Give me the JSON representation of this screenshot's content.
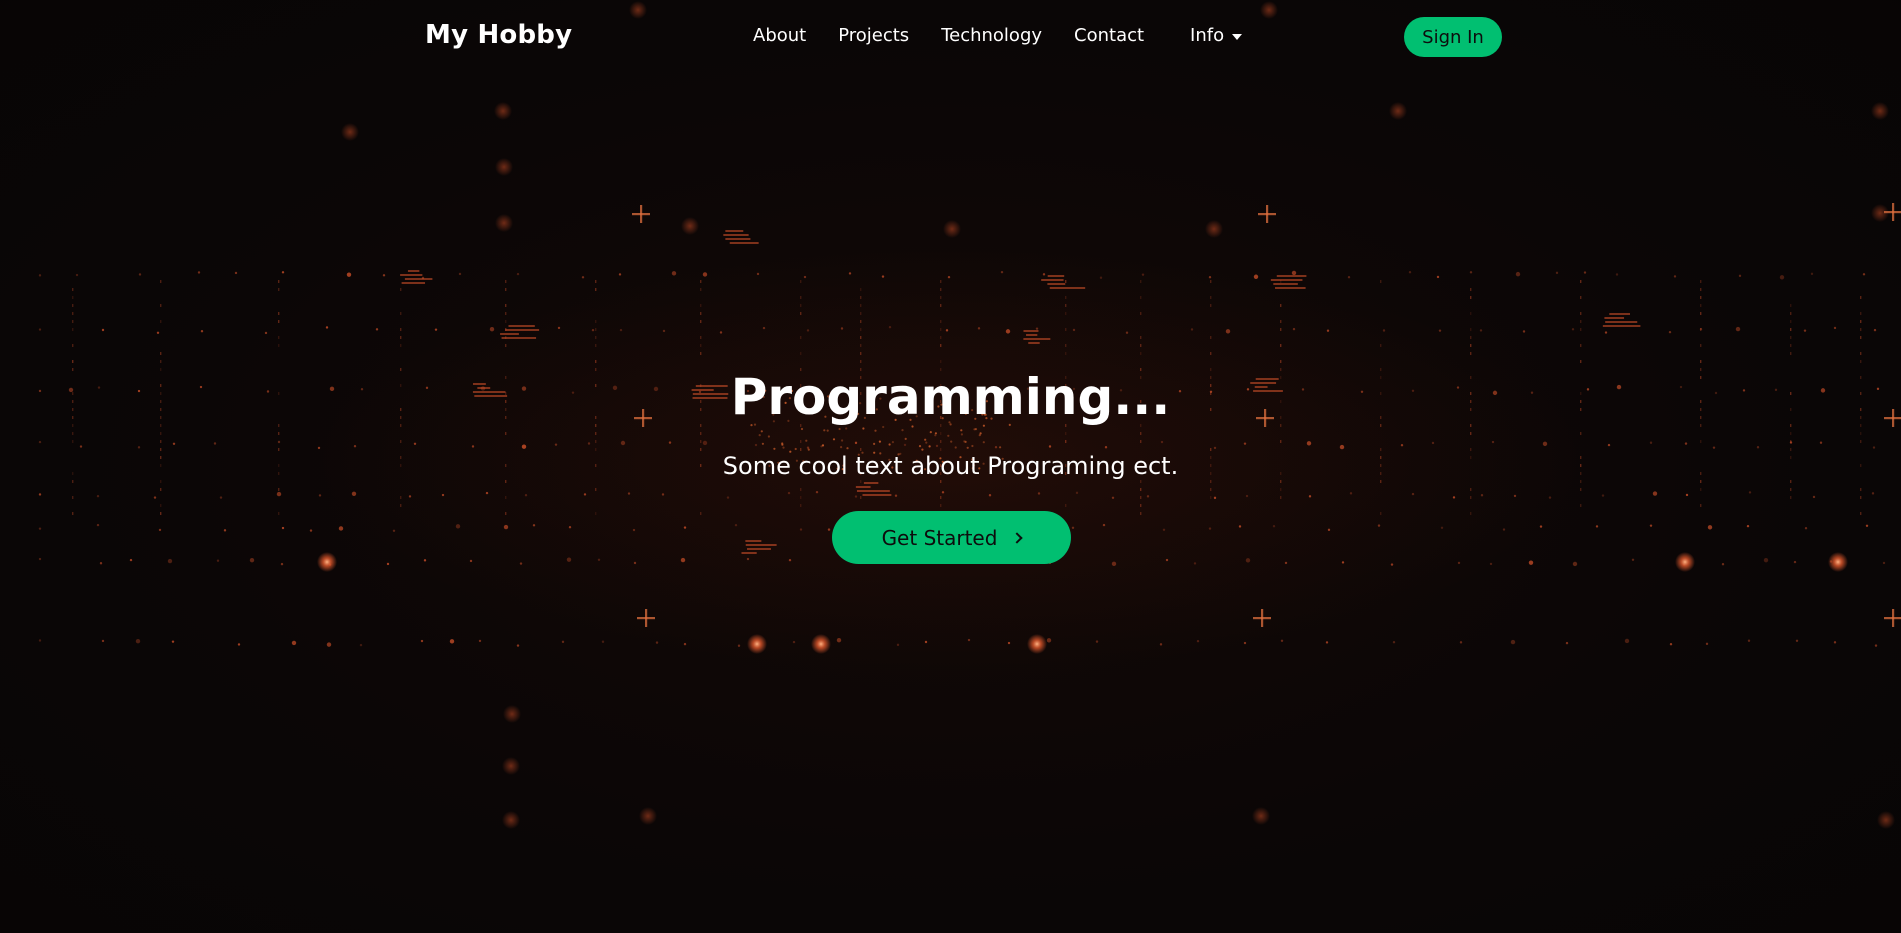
{
  "navbar": {
    "brand": "My Hobby",
    "links": [
      {
        "label": "About"
      },
      {
        "label": "Projects"
      },
      {
        "label": "Technology"
      },
      {
        "label": "Contact"
      }
    ],
    "dropdown": {
      "label": "Info",
      "icon": "caret-down-icon"
    },
    "signin_label": "Sign In"
  },
  "hero": {
    "title": "Programming...",
    "subtitle": "Some cool text about Programing ect.",
    "cta_label": "Get Started",
    "cta_icon": "chevron-right-icon"
  },
  "colors": {
    "accent": "#01bf71",
    "background": "#070505",
    "particle": "#d9542b",
    "text": "#ffffff"
  }
}
